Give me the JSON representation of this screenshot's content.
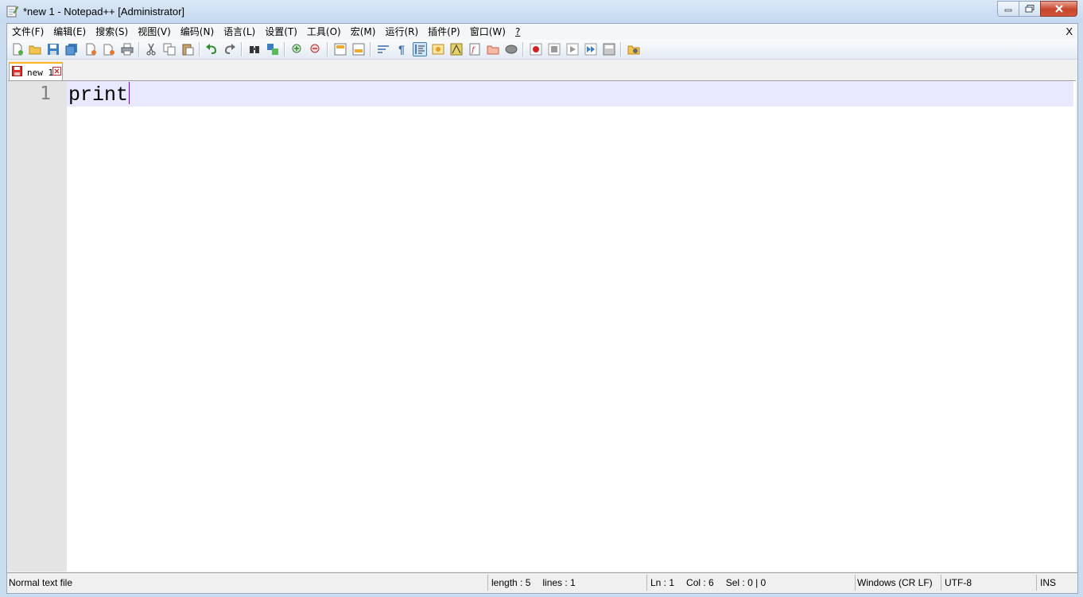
{
  "window": {
    "title": "*new 1 - Notepad++ [Administrator]",
    "icon": "notepad-icon"
  },
  "menu": {
    "items": [
      "文件(F)",
      "编辑(E)",
      "搜索(S)",
      "视图(V)",
      "编码(N)",
      "语言(L)",
      "设置(T)",
      "工具(O)",
      "宏(M)",
      "运行(R)",
      "插件(P)",
      "窗口(W)",
      "?"
    ],
    "close_label": "X"
  },
  "toolbar": {
    "icons": [
      "new-file-icon",
      "open-file-icon",
      "save-icon",
      "save-all-icon",
      "close-icon",
      "close-all-icon",
      "print-icon",
      "cut-icon",
      "copy-icon",
      "paste-icon",
      "undo-icon",
      "redo-icon",
      "find-icon",
      "replace-icon",
      "zoom-in-icon",
      "zoom-out-icon",
      "sync-vertical-icon",
      "sync-horizontal-icon",
      "word-wrap-icon",
      "show-all-chars-icon",
      "indent-guide-icon",
      "user-defined-language-icon",
      "document-map-icon",
      "function-list-icon",
      "folder-as-workspace-icon",
      "monitoring-icon",
      "record-macro-icon",
      "stop-record-icon",
      "play-macro-icon",
      "run-macro-multiple-icon",
      "save-macro-icon",
      "plugin-icon"
    ],
    "active_icon": "indent-guide-icon"
  },
  "tabs": [
    {
      "label": "new 1",
      "modified": true
    }
  ],
  "editor": {
    "lines": [
      {
        "number": "1",
        "text": "print"
      }
    ]
  },
  "status": {
    "file_type": "Normal text file",
    "length": "length : 5",
    "lines": "lines : 1",
    "ln": "Ln : 1",
    "col": "Col : 6",
    "sel": "Sel : 0 | 0",
    "eol": "Windows (CR LF)",
    "encoding": "UTF-8",
    "mode": "INS"
  },
  "colors": {
    "current_line": "#e8e8ff",
    "gutter": "#e4e4e4",
    "caret": "#8000ff",
    "tab_accent": "#fab41e"
  }
}
